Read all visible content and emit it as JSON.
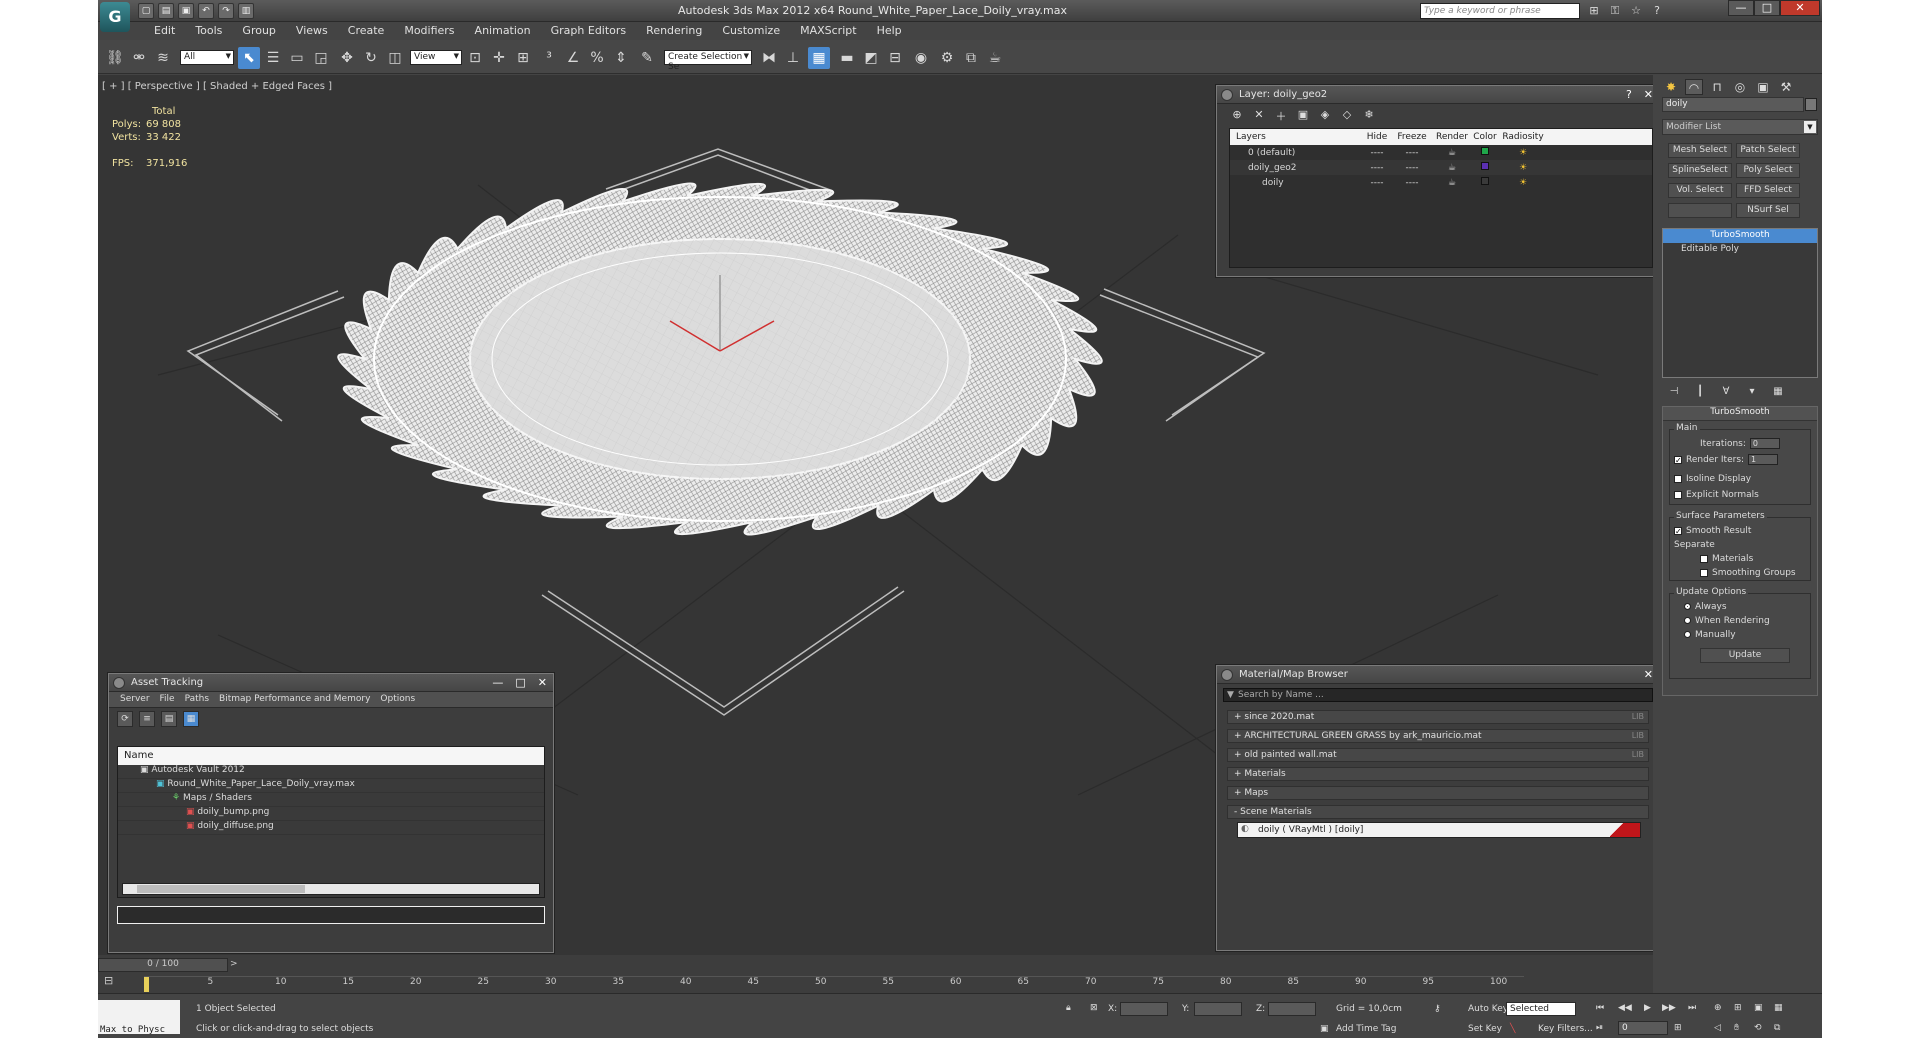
{
  "window": {
    "logo": "G",
    "title": "Autodesk 3ds Max  2012 x64    Round_White_Paper_Lace_Doily_vray.max",
    "search_placeholder": "Type a keyword or phrase",
    "controls": [
      "—",
      "□",
      "✕"
    ]
  },
  "menu": [
    "Edit",
    "Tools",
    "Group",
    "Views",
    "Create",
    "Modifiers",
    "Animation",
    "Graph Editors",
    "Rendering",
    "Customize",
    "MAXScript",
    "Help"
  ],
  "toolbar": {
    "selection_filter": "All",
    "reference_coord": "View",
    "named_selection": "Create Selection Se"
  },
  "viewport": {
    "label": "[ + ] [ Perspective ] [ Shaded + Edged Faces ]",
    "stats": {
      "header": "Total",
      "polys_label": "Polys:",
      "polys": "69 808",
      "verts_label": "Verts:",
      "verts": "33 422",
      "fps_label": "FPS:",
      "fps": "371,916"
    }
  },
  "layer_panel": {
    "title": "Layer: doily_geo2",
    "columns": [
      "Layers",
      "Hide",
      "Freeze",
      "Render",
      "Color",
      "Radiosity"
    ],
    "rows": [
      {
        "name": "0 (default)",
        "hide": "----",
        "freeze": "----",
        "color": "#1fa64a"
      },
      {
        "name": "doily_geo2",
        "hide": "----",
        "freeze": "----",
        "color": "#5a2fb0"
      },
      {
        "name": "doily",
        "hide": "----",
        "freeze": "----",
        "color": "#3a3a3a"
      }
    ]
  },
  "asset_tracking": {
    "title": "Asset Tracking",
    "menu": [
      "Server",
      "File",
      "Paths",
      "Bitmap Performance and Memory",
      "Options"
    ],
    "column": "Name",
    "rows": [
      "Autodesk Vault 2012",
      "Round_White_Paper_Lace_Doily_vray.max",
      "Maps / Shaders",
      "doily_bump.png",
      "doily_diffuse.png"
    ]
  },
  "material_browser": {
    "title": "Material/Map Browser",
    "search_placeholder": "Search by Name ...",
    "lib_tag": "LIB",
    "libraries": [
      "+ since 2020.mat",
      "+ ARCHITECTURAL GREEN GRASS by ark_mauricio.mat",
      "+ old painted wall.mat"
    ],
    "groups": [
      "+ Materials",
      "+ Maps",
      "- Scene Materials"
    ],
    "scene_material": "doily  ( VRayMtl )  [doily]"
  },
  "command_panel": {
    "object_name": "doily",
    "modifier_list": "Modifier List",
    "mod_buttons": [
      "Mesh Select",
      "Patch Select",
      "SplineSelect",
      "Poly Select",
      "Vol. Select",
      "FFD Select",
      "",
      "NSurf Sel"
    ],
    "stack": [
      "TurboSmooth",
      "Editable Poly"
    ],
    "rollout_title": "TurboSmooth",
    "main_label": "Main",
    "iterations_label": "Iterations:",
    "iterations": "0",
    "render_iters_label": "Render Iters:",
    "render_iters": "1",
    "isoline_display": "Isoline Display",
    "explicit_normals": "Explicit Normals",
    "surface_params": "Surface Parameters",
    "smooth_result": "Smooth Result",
    "separate": "Separate",
    "materials": "Materials",
    "smoothing_groups": "Smoothing Groups",
    "update_options": "Update Options",
    "always": "Always",
    "when_rendering": "When Rendering",
    "manually": "Manually",
    "update_button": "Update"
  },
  "timeline": {
    "slider": "0 / 100",
    "ticks": [
      "5",
      "10",
      "15",
      "20",
      "25",
      "30",
      "35",
      "40",
      "45",
      "50",
      "55",
      "60",
      "65",
      "70",
      "75",
      "80",
      "85",
      "90",
      "95",
      "100"
    ]
  },
  "status": {
    "maxscript": "Max to Physc",
    "selection": "1 Object Selected",
    "prompt": "Click or click-and-drag to select objects",
    "x_label": "X:",
    "y_label": "Y:",
    "z_label": "Z:",
    "grid": "Grid = 10,0cm",
    "add_time_tag": "Add Time Tag",
    "auto_key": "Auto Key",
    "set_key": "Set Key",
    "selected": "Selected",
    "key_filters": "Key Filters...",
    "frame": "0"
  }
}
